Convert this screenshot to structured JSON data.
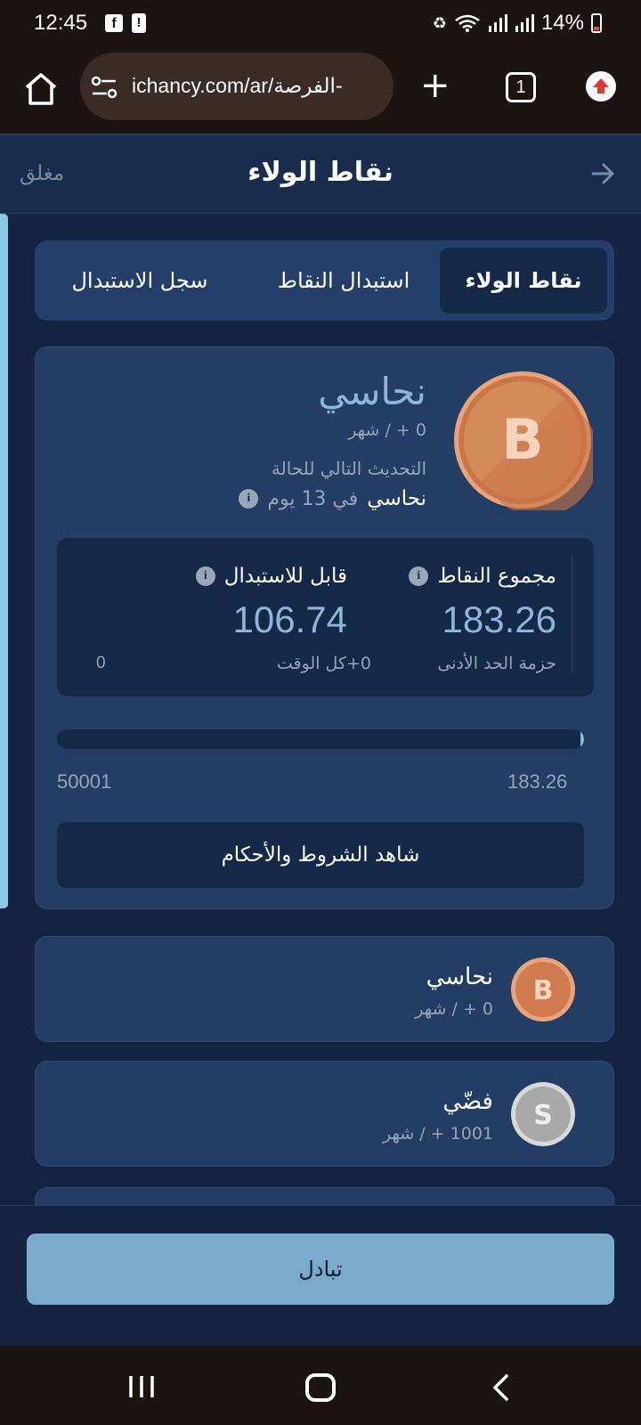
{
  "status_bar": {
    "time": "12:45",
    "battery": "14%",
    "icons": [
      "facebook-icon",
      "alert-icon",
      "recycle-icon",
      "wifi-icon",
      "signal-icon",
      "battery-icon"
    ]
  },
  "browser": {
    "url": "ichancy.com/ar/الفرصة-",
    "tab_count": "1",
    "icons": [
      "home-icon",
      "site-settings-icon",
      "plus-icon",
      "update-icon"
    ]
  },
  "header": {
    "title": "نقاط الولاء",
    "close_label": "مغلق"
  },
  "tabs": [
    {
      "label": "نقاط الولاء",
      "active": true
    },
    {
      "label": "استبدال النقاط",
      "active": false
    },
    {
      "label": "سجل الاستبدال",
      "active": false
    }
  ],
  "loyalty": {
    "tier_name": "نحاسي",
    "tier_sub": "0 + / شهر",
    "next_update_label": "التحديث التالي للحالة",
    "next_tier": "نحاسي",
    "next_days": "في 13 يوم",
    "coin_letter": "B"
  },
  "stats": {
    "total_points_label": "مجموع النقاط",
    "total_points_value": "183.26",
    "redeemable_label": "قابل للاستبدال",
    "redeemable_value": "106.74",
    "min_package_label": "حزمة الحد الأدنى",
    "all_time_label": "0+كل الوقت",
    "zero_value": "0"
  },
  "progress": {
    "current": "183.26",
    "target": "50001",
    "fraction": 0.0037
  },
  "terms_button": "شاهد الشروط والأحكام",
  "tier_list": [
    {
      "name": "نحاسي",
      "sub": "0 + / شهر",
      "letter": "B",
      "color": "#d07a4f"
    },
    {
      "name": "فضّي",
      "sub": "1001 + / شهر",
      "letter": "S",
      "color": "#a7a7a7"
    }
  ],
  "exchange_button": "تبادل",
  "colors": {
    "background": "#14233f",
    "card": "#233d64",
    "accent": "#8ab7db",
    "button": "#7aabcb",
    "bronze": "#d07a4f"
  }
}
